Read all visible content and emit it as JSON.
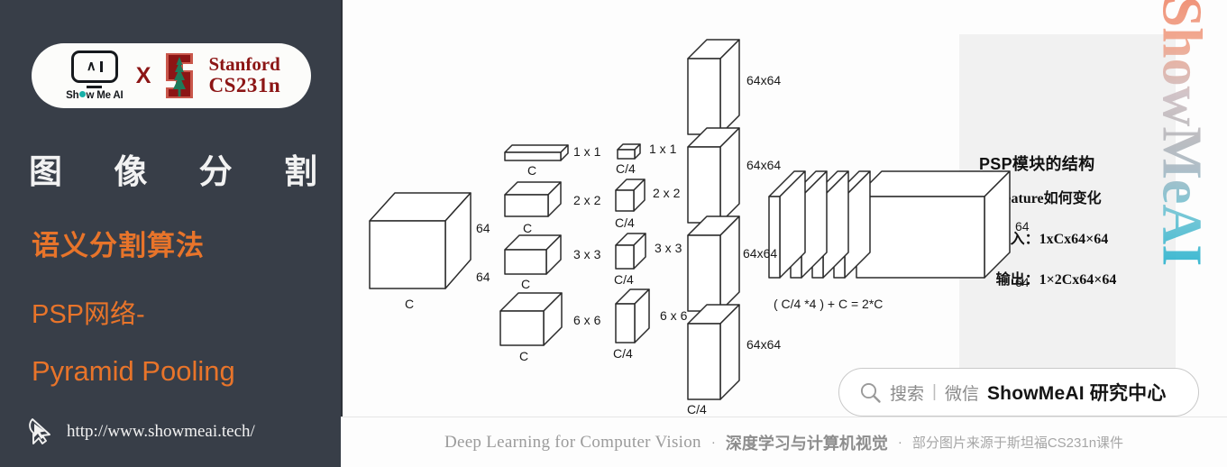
{
  "brand": {
    "logo_name": "Show Me AI",
    "cross": "X",
    "partner_line1": "Stanford",
    "partner_line2": "CS231n"
  },
  "left": {
    "title_chars": [
      "图",
      "像",
      "分",
      "割"
    ],
    "subtitle_1": "语义分割算法",
    "subtitle_2": "PSP网络-",
    "subtitle_3": "Pyramid Pooling",
    "url": "http://www.showmeai.tech/",
    "accent_color": "#E8742A",
    "bg_color": "#383E48",
    "title_color": "#F2F2F2"
  },
  "info_box": {
    "title": "PSP模块的结构",
    "bullets": [
      "Feature如何变化",
      "输入：1xCx64×64",
      "输出：1×2Cx64×64"
    ],
    "bullet_glyph": "•"
  },
  "watermark": {
    "text": "ShowMeAI"
  },
  "search": {
    "label": "搜索",
    "divider": "|",
    "channel": "微信",
    "brand": "ShowMeAI 研究中心",
    "icon": "search-icon"
  },
  "footer": {
    "english": "Deep Learning for Computer Vision",
    "sep": "·",
    "chinese_bold": "深度学习与计算机视觉",
    "chinese_note": "部分图片来源于斯坦福CS231n课件"
  },
  "diagram": {
    "input": {
      "label_bottom": "C",
      "label_right_top": "64",
      "label_right_bottom": "64"
    },
    "pool_column": [
      {
        "kernel": "1 x 1",
        "channels": "C"
      },
      {
        "kernel": "2 x 2",
        "channels": "C"
      },
      {
        "kernel": "3 x 3",
        "channels": "C"
      },
      {
        "kernel": "6 x 6",
        "channels": "C"
      }
    ],
    "reduce_column": [
      {
        "kernel": "1 x 1",
        "channels": "C/4"
      },
      {
        "kernel": "2 x 2",
        "channels": "C/4"
      },
      {
        "kernel": "3 x 3",
        "channels": "C/4"
      },
      {
        "kernel": "6 x 6",
        "channels": "C/4"
      }
    ],
    "upsample_column": {
      "labels": [
        "64x64",
        "64x64",
        "64x64",
        "64x64"
      ],
      "channels": "C/4"
    },
    "concat": {
      "formula": "( C/4 *4 ) + C = 2*C",
      "label_right_top": "64",
      "label_right_bottom": "64"
    }
  }
}
